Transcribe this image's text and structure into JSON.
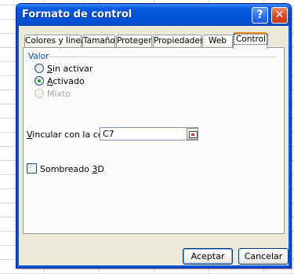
{
  "dialog": {
    "title": "Formato de control",
    "help_label": "?",
    "close_label": "✕"
  },
  "tabs": [
    {
      "label": "Colores y líneas"
    },
    {
      "label": "Tamaño"
    },
    {
      "label": "Proteger"
    },
    {
      "label": "Propiedades"
    },
    {
      "label": "Web"
    },
    {
      "label": "Control",
      "selected": true
    }
  ],
  "control": {
    "group_label": "Valor",
    "options": [
      {
        "mnemonic": "S",
        "rest": "in activar",
        "selected": false,
        "enabled": true
      },
      {
        "mnemonic": "A",
        "rest": "ctivado",
        "selected": true,
        "enabled": true
      },
      {
        "mnemonic": "",
        "rest": "Mixto",
        "selected": false,
        "enabled": false
      }
    ],
    "link_label_mnemonic": "V",
    "link_label_rest": "incular con la celda:",
    "link_value": "C7",
    "shading_label_pre": "Sombreado ",
    "shading_label_mnemonic": "3",
    "shading_label_post": "D",
    "shading_checked": false
  },
  "footer": {
    "ok_label": "Aceptar",
    "cancel_label": "Cancelar"
  },
  "colors": {
    "title_bar": "#0352d4",
    "dialog_face": "#ece9d8",
    "active_tab_accent": "#e68b2c",
    "group_label": "#0046d5"
  }
}
